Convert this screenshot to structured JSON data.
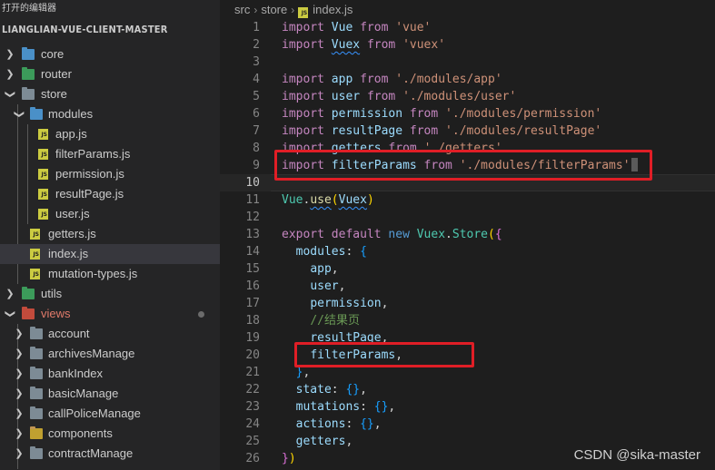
{
  "sidebar": {
    "open_editors_label": "打开的编辑器",
    "project_title": "LIANGLIAN-VUE-CLIENT-MASTER",
    "items": [
      {
        "label": "core",
        "type": "folder",
        "icon": "folder-core-icon",
        "color": "#4a90c8"
      },
      {
        "label": "router",
        "type": "folder",
        "icon": "folder-router-icon",
        "color": "#3c9b5a"
      },
      {
        "label": "store",
        "type": "folder",
        "icon": "folder-store-icon",
        "color": "#7d8b95",
        "expanded": true
      },
      {
        "label": "modules",
        "type": "folder",
        "icon": "folder-modules-icon",
        "color": "#4a90c8",
        "expanded": true
      },
      {
        "label": "app.js",
        "type": "file",
        "icon": "js-file-icon"
      },
      {
        "label": "filterParams.js",
        "type": "file",
        "icon": "js-file-icon"
      },
      {
        "label": "permission.js",
        "type": "file",
        "icon": "js-file-icon"
      },
      {
        "label": "resultPage.js",
        "type": "file",
        "icon": "js-file-icon"
      },
      {
        "label": "user.js",
        "type": "file",
        "icon": "js-file-icon"
      },
      {
        "label": "getters.js",
        "type": "file",
        "icon": "js-file-icon"
      },
      {
        "label": "index.js",
        "type": "file",
        "icon": "js-file-icon",
        "active": true
      },
      {
        "label": "mutation-types.js",
        "type": "file",
        "icon": "js-file-icon"
      },
      {
        "label": "utils",
        "type": "folder",
        "icon": "folder-utils-icon",
        "color": "#3c9b5a"
      },
      {
        "label": "views",
        "type": "folder",
        "icon": "folder-views-icon",
        "color": "#c24b3c",
        "expanded": true
      },
      {
        "label": "account",
        "type": "folder",
        "icon": "folder-icon",
        "color": "#7d8b95"
      },
      {
        "label": "archivesManage",
        "type": "folder",
        "icon": "folder-icon",
        "color": "#7d8b95"
      },
      {
        "label": "bankIndex",
        "type": "folder",
        "icon": "folder-icon",
        "color": "#7d8b95"
      },
      {
        "label": "basicManage",
        "type": "folder",
        "icon": "folder-icon",
        "color": "#7d8b95"
      },
      {
        "label": "callPoliceManage",
        "type": "folder",
        "icon": "folder-icon",
        "color": "#7d8b95"
      },
      {
        "label": "components",
        "type": "folder",
        "icon": "folder-components-icon",
        "color": "#c0a030"
      },
      {
        "label": "contractManage",
        "type": "folder",
        "icon": "folder-icon",
        "color": "#7d8b95"
      }
    ]
  },
  "breadcrumb": {
    "parts": [
      "src",
      "store",
      "index.js"
    ]
  },
  "editor": {
    "current_line": 10,
    "lines": [
      {
        "n": "1",
        "tokens": [
          [
            "k",
            "import"
          ],
          [
            "p",
            " "
          ],
          [
            "v",
            "Vue"
          ],
          [
            "p",
            " "
          ],
          [
            "k",
            "from"
          ],
          [
            "p",
            " "
          ],
          [
            "s",
            "'vue'"
          ]
        ]
      },
      {
        "n": "2",
        "tokens": [
          [
            "k",
            "import"
          ],
          [
            "p",
            " "
          ],
          [
            "v",
            "Vuex"
          ],
          [
            "p",
            " "
          ],
          [
            "k",
            "from"
          ],
          [
            "p",
            " "
          ],
          [
            "s",
            "'vuex'"
          ]
        ]
      },
      {
        "n": "3",
        "tokens": []
      },
      {
        "n": "4",
        "tokens": [
          [
            "k",
            "import"
          ],
          [
            "p",
            " "
          ],
          [
            "v",
            "app"
          ],
          [
            "p",
            " "
          ],
          [
            "k",
            "from"
          ],
          [
            "p",
            " "
          ],
          [
            "s",
            "'./modules/app'"
          ]
        ]
      },
      {
        "n": "5",
        "tokens": [
          [
            "k",
            "import"
          ],
          [
            "p",
            " "
          ],
          [
            "v",
            "user"
          ],
          [
            "p",
            " "
          ],
          [
            "k",
            "from"
          ],
          [
            "p",
            " "
          ],
          [
            "s",
            "'./modules/user'"
          ]
        ]
      },
      {
        "n": "6",
        "tokens": [
          [
            "k",
            "import"
          ],
          [
            "p",
            " "
          ],
          [
            "v",
            "permission"
          ],
          [
            "p",
            " "
          ],
          [
            "k",
            "from"
          ],
          [
            "p",
            " "
          ],
          [
            "s",
            "'./modules/permission'"
          ]
        ]
      },
      {
        "n": "7",
        "tokens": [
          [
            "k",
            "import"
          ],
          [
            "p",
            " "
          ],
          [
            "v",
            "resultPage"
          ],
          [
            "p",
            " "
          ],
          [
            "k",
            "from"
          ],
          [
            "p",
            " "
          ],
          [
            "s",
            "'./modules/resultPage'"
          ]
        ]
      },
      {
        "n": "8",
        "tokens": [
          [
            "k",
            "import"
          ],
          [
            "p",
            " "
          ],
          [
            "v",
            "getters"
          ],
          [
            "p",
            " "
          ],
          [
            "k",
            "from"
          ],
          [
            "p",
            " "
          ],
          [
            "s",
            "'./getters'"
          ]
        ]
      },
      {
        "n": "9",
        "tokens": [
          [
            "k",
            "import"
          ],
          [
            "p",
            " "
          ],
          [
            "v",
            "filterParams"
          ],
          [
            "p",
            " "
          ],
          [
            "k",
            "from"
          ],
          [
            "p",
            " "
          ],
          [
            "s",
            "'./modules/filterParams'"
          ]
        ]
      },
      {
        "n": "10",
        "tokens": []
      },
      {
        "n": "11",
        "tokens": [
          [
            "t",
            "Vue"
          ],
          [
            "p",
            "."
          ],
          [
            "f",
            "use"
          ],
          [
            "br3",
            "("
          ],
          [
            "v",
            "Vuex"
          ],
          [
            "br3",
            ")"
          ]
        ]
      },
      {
        "n": "12",
        "tokens": []
      },
      {
        "n": "13",
        "tokens": [
          [
            "k",
            "export"
          ],
          [
            "p",
            " "
          ],
          [
            "k",
            "default"
          ],
          [
            "p",
            " "
          ],
          [
            "kb",
            "new"
          ],
          [
            "p",
            " "
          ],
          [
            "t",
            "Vuex"
          ],
          [
            "p",
            "."
          ],
          [
            "t",
            "Store"
          ],
          [
            "br3",
            "("
          ],
          [
            "br",
            "{"
          ]
        ]
      },
      {
        "n": "14",
        "tokens": [
          [
            "p",
            "  "
          ],
          [
            "v",
            "modules"
          ],
          [
            "p",
            ": "
          ],
          [
            "br2",
            "{"
          ]
        ]
      },
      {
        "n": "15",
        "tokens": [
          [
            "p",
            "    "
          ],
          [
            "v",
            "app"
          ],
          [
            "p",
            ","
          ]
        ]
      },
      {
        "n": "16",
        "tokens": [
          [
            "p",
            "    "
          ],
          [
            "v",
            "user"
          ],
          [
            "p",
            ","
          ]
        ]
      },
      {
        "n": "17",
        "tokens": [
          [
            "p",
            "    "
          ],
          [
            "v",
            "permission"
          ],
          [
            "p",
            ","
          ]
        ]
      },
      {
        "n": "18",
        "tokens": [
          [
            "p",
            "    "
          ],
          [
            "c",
            "//结果页"
          ]
        ]
      },
      {
        "n": "19",
        "tokens": [
          [
            "p",
            "    "
          ],
          [
            "v",
            "resultPage"
          ],
          [
            "p",
            ","
          ]
        ]
      },
      {
        "n": "20",
        "tokens": [
          [
            "p",
            "    "
          ],
          [
            "v",
            "filterParams"
          ],
          [
            "p",
            ","
          ]
        ]
      },
      {
        "n": "21",
        "tokens": [
          [
            "p",
            "  "
          ],
          [
            "br2",
            "}"
          ],
          [
            "p",
            ","
          ]
        ]
      },
      {
        "n": "22",
        "tokens": [
          [
            "p",
            "  "
          ],
          [
            "v",
            "state"
          ],
          [
            "p",
            ": "
          ],
          [
            "br2",
            "{}"
          ],
          [
            "p",
            ","
          ]
        ]
      },
      {
        "n": "23",
        "tokens": [
          [
            "p",
            "  "
          ],
          [
            "v",
            "mutations"
          ],
          [
            "p",
            ": "
          ],
          [
            "br2",
            "{}"
          ],
          [
            "p",
            ","
          ]
        ]
      },
      {
        "n": "24",
        "tokens": [
          [
            "p",
            "  "
          ],
          [
            "v",
            "actions"
          ],
          [
            "p",
            ": "
          ],
          [
            "br2",
            "{}"
          ],
          [
            "p",
            ","
          ]
        ]
      },
      {
        "n": "25",
        "tokens": [
          [
            "p",
            "  "
          ],
          [
            "v",
            "getters"
          ],
          [
            "p",
            ","
          ]
        ]
      },
      {
        "n": "26",
        "tokens": [
          [
            "br",
            "}"
          ],
          [
            "br3",
            ")"
          ]
        ]
      }
    ]
  },
  "watermark": "CSDN @sika-master",
  "colors": {
    "highlight": "#e01e26",
    "keyword": "#c586c0",
    "string": "#ce9178",
    "variable": "#9cdcfe",
    "comment": "#6a9955"
  }
}
